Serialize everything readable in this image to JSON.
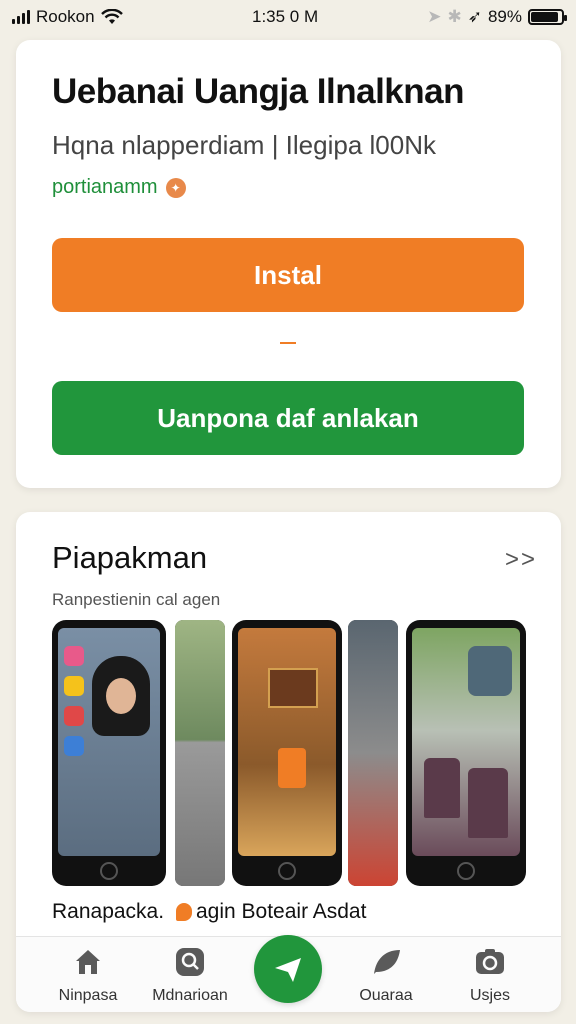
{
  "status_bar": {
    "carrier": "Rookon",
    "time": "1:35 0 M",
    "battery": "89%",
    "battery_level": 0.89
  },
  "app": {
    "title": "Uebanai Uangja Ilnalknan",
    "subtitle": "Hqna nlapperdiam | Ilegipa l00Nk",
    "developer": "portianamm",
    "install_label": "Instal",
    "open_label": "Uanpona daf anlakan"
  },
  "screenshots": {
    "title": "Piapakman",
    "more": ">>",
    "caption": "Ranpestienin cal agen",
    "label_1": "Ranapacka.",
    "label_2": "agin Boteair Asdat"
  },
  "bottom_nav": {
    "items": [
      {
        "label": "Ninpasa",
        "icon": "home-icon"
      },
      {
        "label": "Mdnarioan",
        "icon": "search-icon"
      },
      {
        "label": "",
        "icon": "send-icon"
      },
      {
        "label": "Ouaraa",
        "icon": "leaf-icon"
      },
      {
        "label": "Usjes",
        "icon": "camera-icon"
      }
    ]
  },
  "colors": {
    "accent_orange": "#f07d25",
    "accent_green": "#21963c",
    "background": "#f2efe6"
  }
}
